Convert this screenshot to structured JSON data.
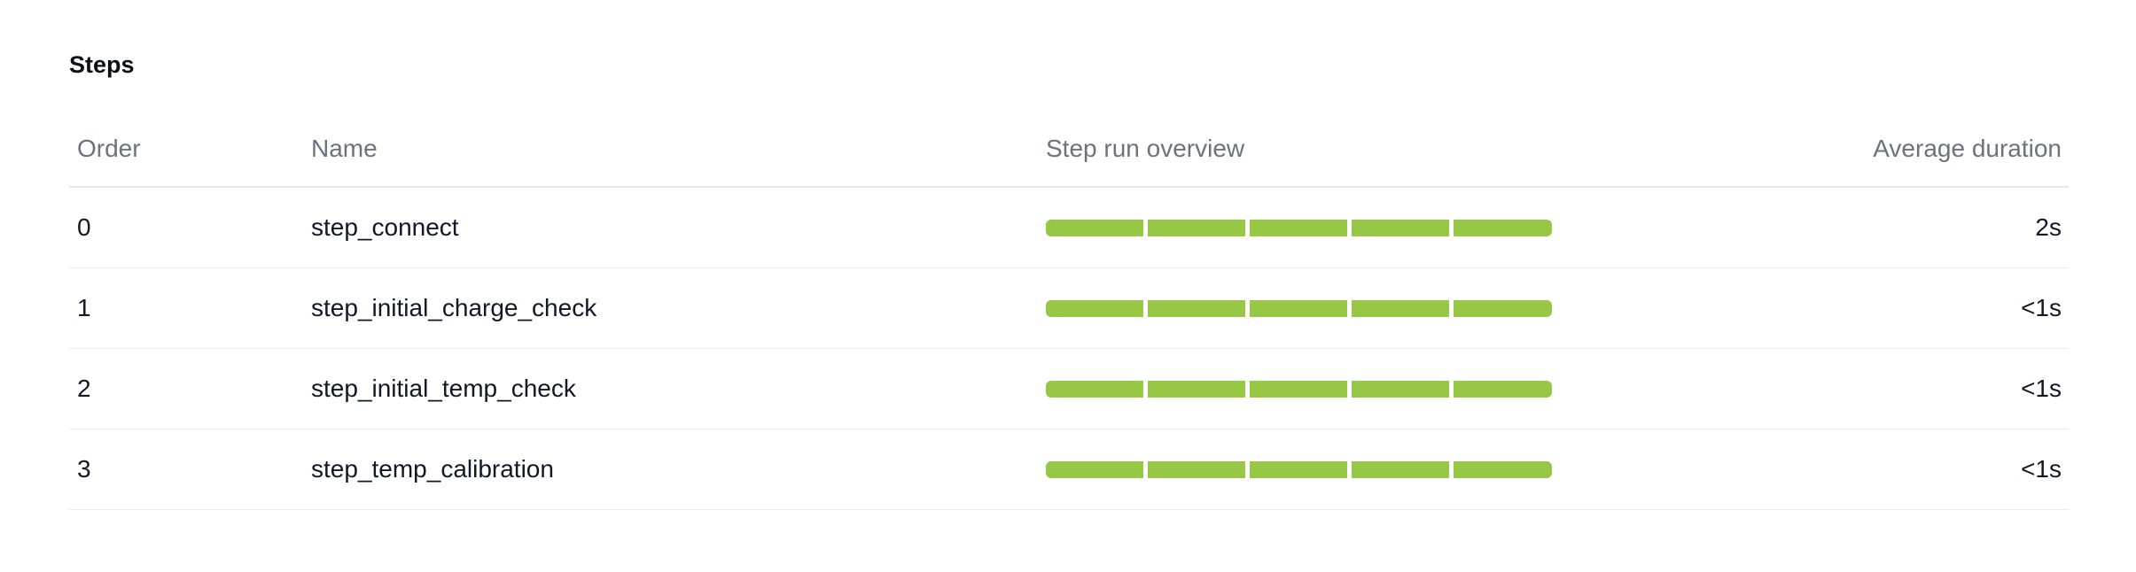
{
  "section": {
    "title": "Steps"
  },
  "table": {
    "columns": {
      "order": "Order",
      "name": "Name",
      "overview": "Step run overview",
      "duration": "Average duration"
    },
    "rows": [
      {
        "order": "0",
        "name": "step_connect",
        "overview_segments": [
          "passed",
          "passed",
          "passed",
          "passed",
          "passed"
        ],
        "duration": "2s"
      },
      {
        "order": "1",
        "name": "step_initial_charge_check",
        "overview_segments": [
          "passed",
          "passed",
          "passed",
          "passed",
          "passed"
        ],
        "duration": "<1s"
      },
      {
        "order": "2",
        "name": "step_initial_temp_check",
        "overview_segments": [
          "passed",
          "passed",
          "passed",
          "passed",
          "passed"
        ],
        "duration": "<1s"
      },
      {
        "order": "3",
        "name": "step_temp_calibration",
        "overview_segments": [
          "passed",
          "passed",
          "passed",
          "passed",
          "passed"
        ],
        "duration": "<1s"
      }
    ]
  },
  "colors": {
    "passed": "#96c846",
    "header_text": "#6b7280",
    "divider": "#e5e7eb"
  }
}
